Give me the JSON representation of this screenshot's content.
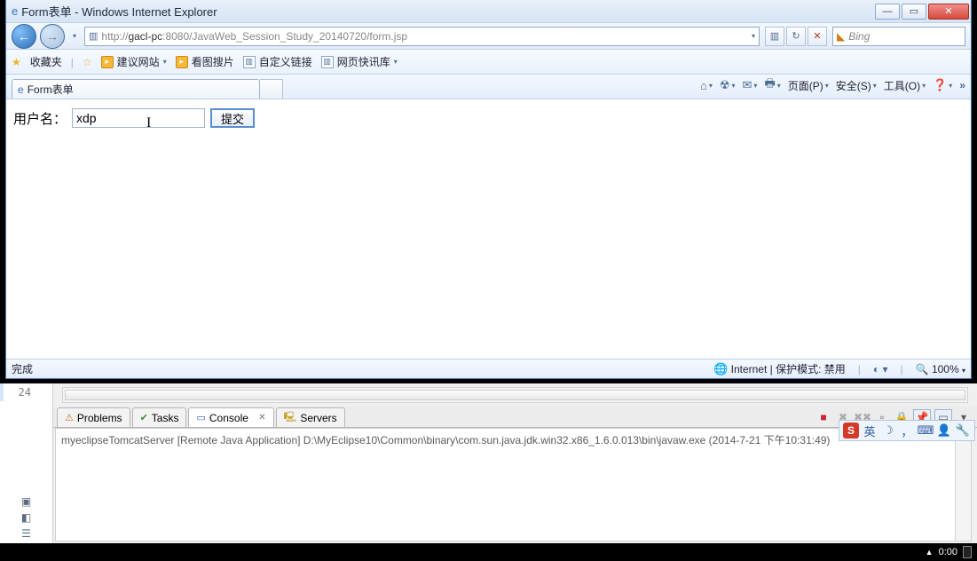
{
  "window": {
    "title": "Form表单 - Windows Internet Explorer"
  },
  "address": {
    "scheme": "http://",
    "host": "gacl-pc",
    "port": ":8080",
    "path": "/JavaWeb_Session_Study_20140720/form.jsp"
  },
  "search": {
    "engine_label": "Bing"
  },
  "favbar": {
    "label": "收藏夹",
    "links": [
      "建议网站",
      "看图搜片",
      "自定义链接",
      "网页快讯库"
    ]
  },
  "tab": {
    "title": "Form表单"
  },
  "cmdbar": {
    "page": "页面(P)",
    "safety": "安全(S)",
    "tools": "工具(O)"
  },
  "page": {
    "label": "用户名：",
    "input_value": "xdp",
    "submit_label": "提交"
  },
  "status": {
    "left": "完成",
    "zone": "Internet | 保护模式: 禁用",
    "zoom": "100%"
  },
  "eclipse": {
    "gutter_line": "24",
    "tabs": {
      "problems": "Problems",
      "tasks": "Tasks",
      "console": "Console",
      "servers": "Servers"
    },
    "console_line": "myeclipseTomcatServer [Remote Java Application] D:\\MyEclipse10\\Common\\binary\\com.sun.java.jdk.win32.x86_1.6.0.013\\bin\\javaw.exe (2014-7-21 下午10:31:49)"
  },
  "ime": {
    "lang": "英"
  },
  "taskbar": {
    "time": "0:00"
  }
}
